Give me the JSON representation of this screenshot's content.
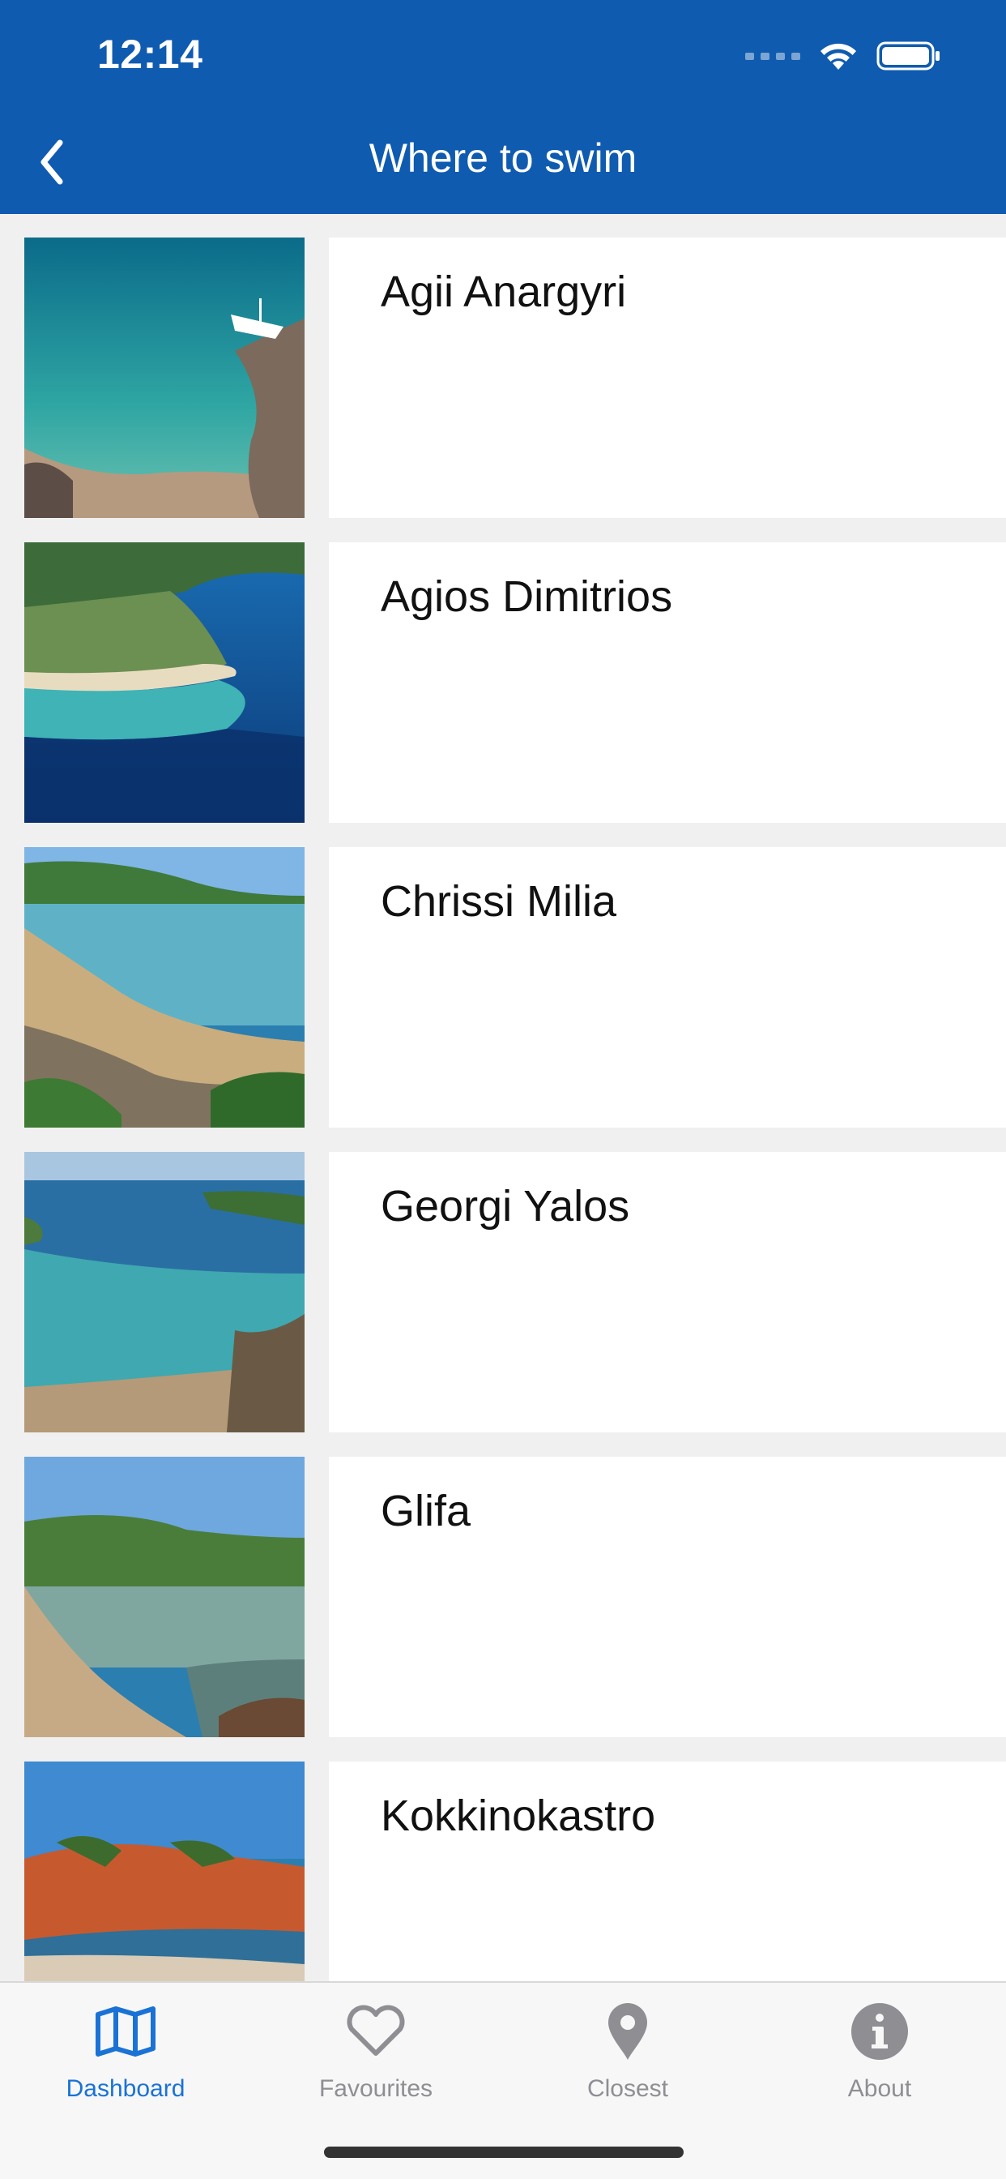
{
  "status_bar": {
    "time": "12:14"
  },
  "nav": {
    "title": "Where to swim",
    "back_icon": "chevron-left-icon"
  },
  "beaches": [
    {
      "name": "Agii Anargyri"
    },
    {
      "name": "Agios Dimitrios"
    },
    {
      "name": "Chrissi Milia"
    },
    {
      "name": "Georgi Yalos"
    },
    {
      "name": "Glifa"
    },
    {
      "name": "Kokkinokastro"
    }
  ],
  "tabs": [
    {
      "label": "Dashboard",
      "icon": "map-icon",
      "active": true
    },
    {
      "label": "Favourites",
      "icon": "heart-icon",
      "active": false
    },
    {
      "label": "Closest",
      "icon": "location-pin-icon",
      "active": false
    },
    {
      "label": "About",
      "icon": "info-icon",
      "active": false
    }
  ],
  "colors": {
    "header": "#0f5bb0",
    "tab_active": "#1a72d6",
    "tab_inactive": "#8e8e93",
    "list_background": "#f0f0f0"
  }
}
